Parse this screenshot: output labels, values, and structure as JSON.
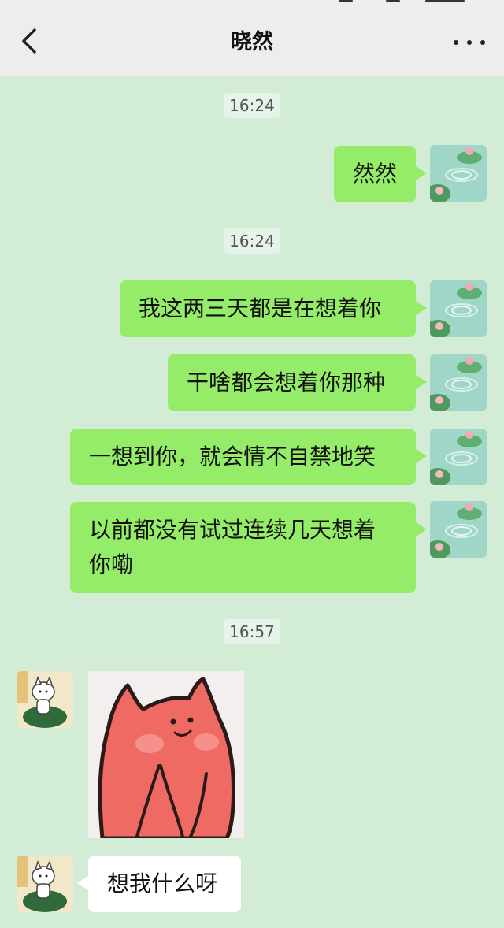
{
  "header": {
    "title": "晓然"
  },
  "colors": {
    "chat_bg": "#d3ecd6",
    "my_bubble": "#95ec69",
    "their_bubble": "#ffffff",
    "header_bg": "#ededed"
  },
  "icons": {
    "back": "back-arrow-icon",
    "more": "more-dots-icon"
  },
  "messages": [
    {
      "type": "time",
      "text": "16:24"
    },
    {
      "type": "text",
      "from": "me",
      "text": "然然"
    },
    {
      "type": "time",
      "text": "16:24"
    },
    {
      "type": "text",
      "from": "me",
      "text": "我这两三天都是在想着你"
    },
    {
      "type": "text",
      "from": "me",
      "text": "干啥都会想着你那种"
    },
    {
      "type": "text",
      "from": "me",
      "text": "一想到你，就会情不自禁地笑"
    },
    {
      "type": "text",
      "from": "me",
      "text": "以前都没有试过连续几天想着你嘞"
    },
    {
      "type": "time",
      "text": "16:57"
    },
    {
      "type": "sticker",
      "from": "them",
      "sticker": "blushing-pink-cat-sticker"
    },
    {
      "type": "text",
      "from": "them",
      "text": "想我什么呀"
    }
  ]
}
